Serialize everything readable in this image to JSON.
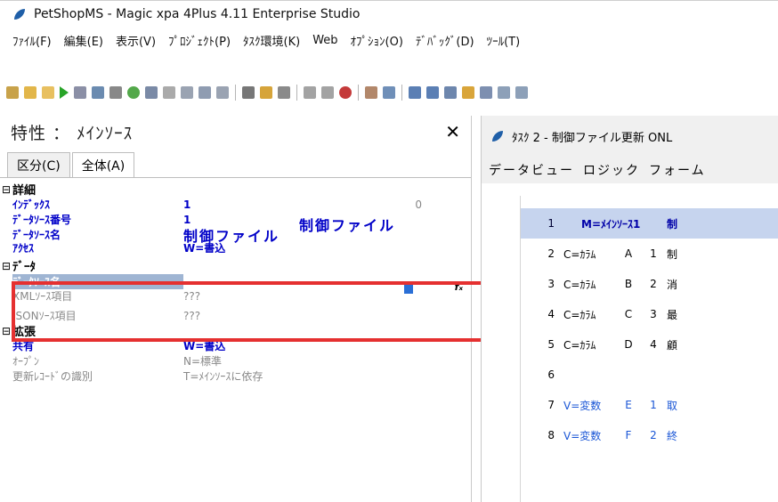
{
  "window": {
    "title": "PetShopMS - Magic xpa 4Plus 4.11 Enterprise Studio"
  },
  "menu": [
    "ﾌｧｲﾙ(F)",
    "編集(E)",
    "表示(V)",
    "ﾌﾟﾛｼﾞｪｸﾄ(P)",
    "ﾀｽｸ環境(K)",
    "Web",
    "ｵﾌﾟｼｮﾝ(O)",
    "ﾃﾞﾊﾞｯｸﾞ(D)",
    "ﾂｰﾙ(T)"
  ],
  "properties": {
    "title": "特性 ： ﾒｲﾝｿｰｽ",
    "tabs": [
      "区分(C)",
      "全体(A)"
    ],
    "categories": {
      "detail": "詳細",
      "data": "ﾃﾞｰﾀ",
      "extension": "拡張"
    },
    "detail_rows": [
      {
        "name": "ｲﾝﾃﾞｯｸｽ",
        "value": "1",
        "extra": "0"
      },
      {
        "name": "ﾃﾞｰﾀｿｰｽ番号",
        "value": "1",
        "extra": "制御ファイル"
      },
      {
        "name": "ﾃﾞｰﾀｿｰｽ名",
        "value": "制御ファイル"
      },
      {
        "name": "ｱｸｾｽ",
        "value": "W=書込"
      }
    ],
    "data_rows": [
      {
        "name": "ﾃﾞｰﾀｿｰｽ名",
        "value": ""
      },
      {
        "name": "XMLｿｰｽ項目",
        "value": "???"
      },
      {
        "name": "JSONｿｰｽ項目",
        "value": "???"
      }
    ],
    "ext_rows": [
      {
        "name": "共有",
        "value": "W=書込"
      },
      {
        "name": "ｵｰﾌﾟﾝ",
        "value": "N=標準"
      },
      {
        "name": "更新ﾚｺｰﾄﾞの識別",
        "value": "T=ﾒｲﾝｿｰｽに依存"
      }
    ],
    "fx_label": "f"
  },
  "task": {
    "title": "ﾀｽｸ 2 -  制御ファイル更新 ONL",
    "tabs": [
      "データビュー",
      "ロジック",
      "フォーム"
    ],
    "rows": [
      {
        "num": "1",
        "type": "M=ﾒｲﾝｿｰｽ1",
        "name": "",
        "id": "",
        "desc": "制"
      },
      {
        "num": "2",
        "type": "C=ｶﾗﾑ",
        "name": "A",
        "id": "1",
        "desc": "制"
      },
      {
        "num": "3",
        "type": "C=ｶﾗﾑ",
        "name": "B",
        "id": "2",
        "desc": "消"
      },
      {
        "num": "4",
        "type": "C=ｶﾗﾑ",
        "name": "C",
        "id": "3",
        "desc": "最"
      },
      {
        "num": "5",
        "type": "C=ｶﾗﾑ",
        "name": "D",
        "id": "4",
        "desc": "顧"
      },
      {
        "num": "6",
        "type": "",
        "name": "",
        "id": "",
        "desc": ""
      },
      {
        "num": "7",
        "type": "V=変数",
        "name": "E",
        "id": "1",
        "desc": "取"
      },
      {
        "num": "8",
        "type": "V=変数",
        "name": "F",
        "id": "2",
        "desc": "終"
      }
    ]
  }
}
